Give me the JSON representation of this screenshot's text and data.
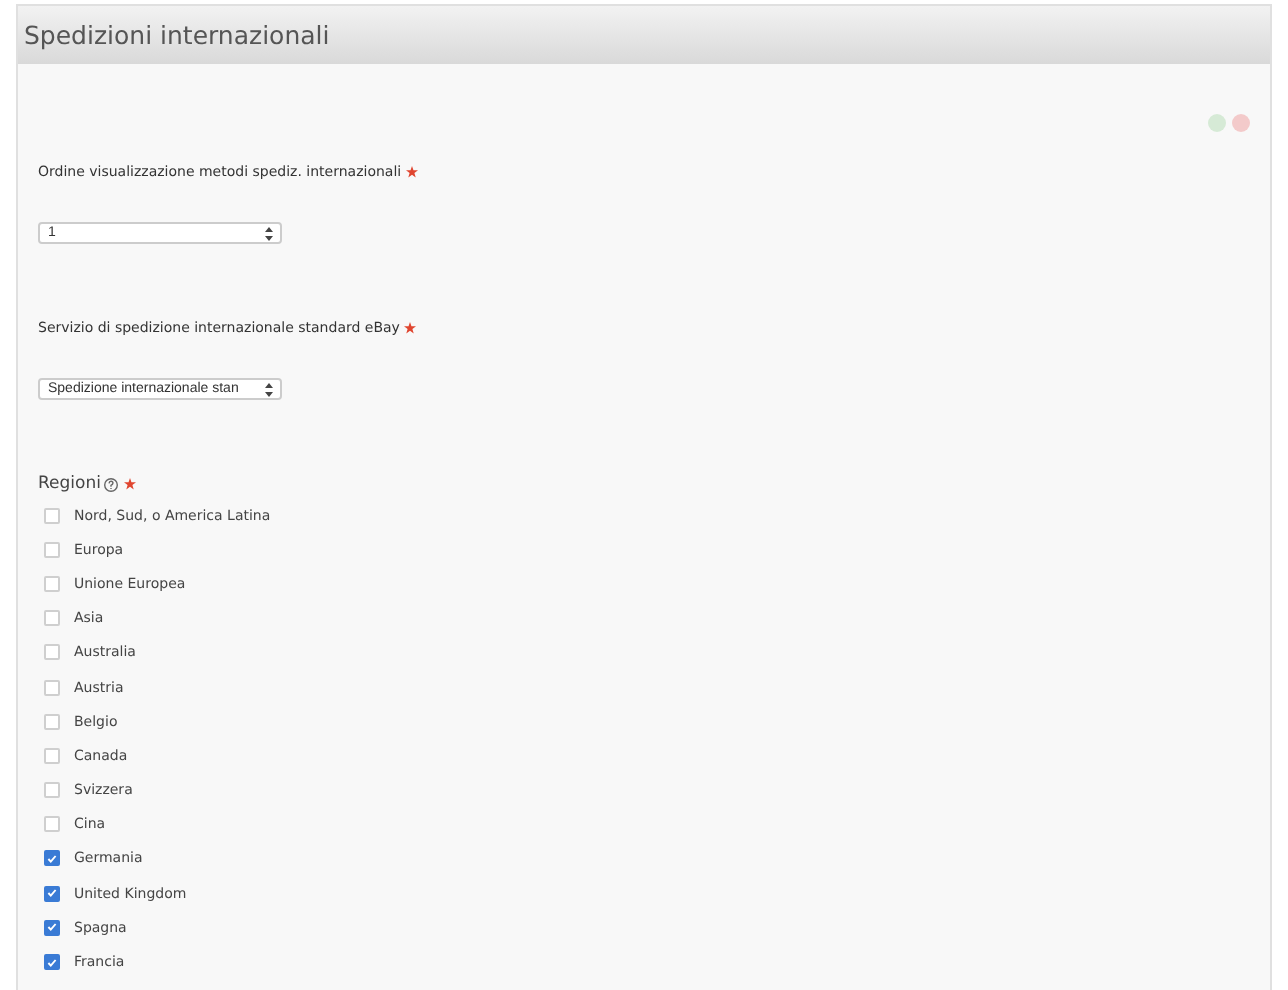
{
  "panel": {
    "title": "Spedizioni internazionali"
  },
  "fields": [
    {
      "label": "Ordine visualizzazione metodi spediz. internazionali",
      "required": true,
      "value": "1"
    },
    {
      "label": "Servizio di spedizione internazionale standard eBay",
      "required": true,
      "value": "Spedizione internazionale stan"
    }
  ],
  "regions": {
    "label": "Regioni",
    "help": true,
    "required": true,
    "items": [
      {
        "label": "Nord, Sud, o America Latina",
        "checked": false
      },
      {
        "label": "Europa",
        "checked": false
      },
      {
        "label": "Unione Europea",
        "checked": false
      },
      {
        "label": "Asia",
        "checked": false
      },
      {
        "label": "Australia",
        "checked": false
      },
      {
        "label": "Austria",
        "checked": false
      },
      {
        "label": "Belgio",
        "checked": false
      },
      {
        "label": "Canada",
        "checked": false
      },
      {
        "label": "Svizzera",
        "checked": false
      },
      {
        "label": "Cina",
        "checked": false
      },
      {
        "label": "Germania",
        "checked": true
      },
      {
        "label": "United Kingdom",
        "checked": true
      },
      {
        "label": "Spagna",
        "checked": true
      },
      {
        "label": "Francia",
        "checked": true
      }
    ]
  }
}
